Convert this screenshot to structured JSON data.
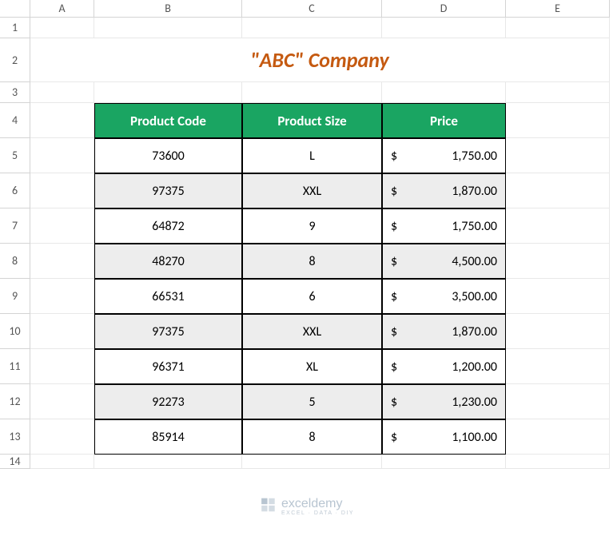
{
  "columns": [
    "A",
    "B",
    "C",
    "D",
    "E"
  ],
  "rows": [
    "1",
    "2",
    "3",
    "4",
    "5",
    "6",
    "7",
    "8",
    "9",
    "10",
    "11",
    "12",
    "13",
    "14"
  ],
  "title": "\"ABC\" Company",
  "headers": {
    "code": "Product Code",
    "size": "Product Size",
    "price": "Price"
  },
  "currency": "$",
  "products": [
    {
      "code": "73600",
      "size": "L",
      "price": "1,750.00"
    },
    {
      "code": "97375",
      "size": "XXL",
      "price": "1,870.00"
    },
    {
      "code": "64872",
      "size": "9",
      "price": "1,750.00"
    },
    {
      "code": "48270",
      "size": "8",
      "price": "4,500.00"
    },
    {
      "code": "66531",
      "size": "6",
      "price": "3,500.00"
    },
    {
      "code": "97375",
      "size": "XXL",
      "price": "1,870.00"
    },
    {
      "code": "96371",
      "size": "XL",
      "price": "1,200.00"
    },
    {
      "code": "92273",
      "size": "5",
      "price": "1,230.00"
    },
    {
      "code": "85914",
      "size": "8",
      "price": "1,100.00"
    }
  ],
  "watermark": {
    "name": "exceldemy",
    "sub": "EXCEL · DATA · DIY"
  },
  "chart_data": {
    "type": "table",
    "title": "\"ABC\" Company",
    "columns": [
      "Product Code",
      "Product Size",
      "Price"
    ],
    "rows": [
      [
        "73600",
        "L",
        1750.0
      ],
      [
        "97375",
        "XXL",
        1870.0
      ],
      [
        "64872",
        "9",
        1750.0
      ],
      [
        "48270",
        "8",
        4500.0
      ],
      [
        "66531",
        "6",
        3500.0
      ],
      [
        "97375",
        "XXL",
        1870.0
      ],
      [
        "96371",
        "XL",
        1200.0
      ],
      [
        "92273",
        "5",
        1230.0
      ],
      [
        "85914",
        "8",
        1100.0
      ]
    ]
  }
}
